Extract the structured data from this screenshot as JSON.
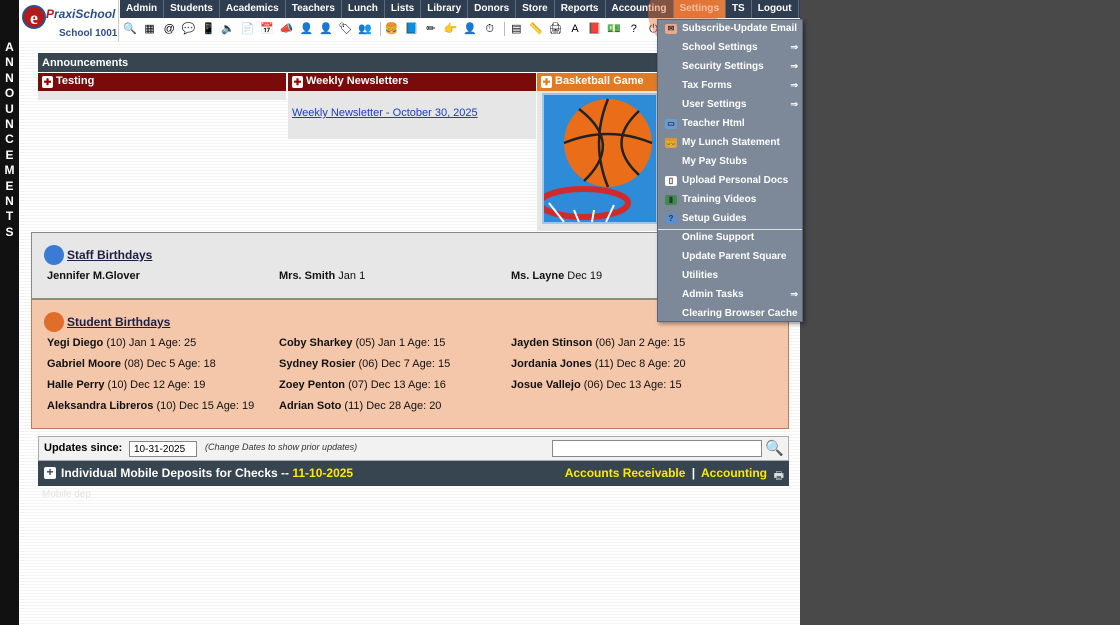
{
  "school": {
    "brand_prefix": "P",
    "brand_rest": "raxiSchool",
    "name": "School 1001",
    "logo_letter": "e"
  },
  "side_label": [
    "A",
    "N",
    "N",
    "O",
    "U",
    "N",
    "C",
    "E",
    "M",
    "E",
    "N",
    "T",
    "S"
  ],
  "nav": [
    "Admin",
    "Students",
    "Academics",
    "Teachers",
    "Lunch",
    "Lists",
    "Library",
    "Donors",
    "Store",
    "Reports",
    "Accounting",
    "Settings",
    "TS",
    "Logout"
  ],
  "toolbar_icons": [
    "search-icon",
    "calendar-grid-icon",
    "at-icon",
    "chat-icon",
    "phone-icon",
    "speaker-icon",
    "document-icon",
    "schedule-icon",
    "megaphone-icon",
    "person-red-icon",
    "person-orange-icon",
    "tag-icon",
    "group-icon",
    "lunch-icon",
    "book-icon",
    "pencil-icon",
    "hand-icon",
    "user-icon",
    "clock-icon",
    "grid-icon",
    "ruler-icon",
    "printer-icon",
    "ap-icon",
    "pdf-icon",
    "money-icon",
    "help-icon",
    "power-icon"
  ],
  "announcements": {
    "header": "Announcements",
    "columns": [
      {
        "title": "Testing",
        "color": "#7a0b0b"
      },
      {
        "title": "Weekly Newsletters",
        "color": "#7a0b0b"
      },
      {
        "title": "Basketball Game",
        "color": "#e27a23"
      }
    ],
    "newsletter_link": "Weekly Newsletter - October 30, 2025"
  },
  "staff_birthdays": {
    "title": "Staff Birthdays",
    "entries": [
      {
        "name": "Jennifer M.Glover",
        "detail": ""
      },
      {
        "name": "Mrs. Smith",
        "detail": "Jan 1"
      },
      {
        "name": "Ms. Layne",
        "detail": "Dec 19"
      }
    ]
  },
  "student_birthdays": {
    "title": "Student Birthdays",
    "entries": [
      {
        "name": "Yegi Diego",
        "detail": "(10) Jan 1 Age: 25"
      },
      {
        "name": "Coby Sharkey",
        "detail": "(05) Jan 1 Age: 15"
      },
      {
        "name": "Jayden Stinson",
        "detail": "(06) Jan 2 Age: 15"
      },
      {
        "name": "Gabriel Moore",
        "detail": "(08) Dec 5 Age: 18"
      },
      {
        "name": "Sydney Rosier",
        "detail": "(06) Dec 7 Age: 15"
      },
      {
        "name": "Jordania Jones",
        "detail": "(11) Dec 8 Age: 20"
      },
      {
        "name": "Halle Perry",
        "detail": "(10) Dec 12 Age: 19"
      },
      {
        "name": "Zoey Penton",
        "detail": "(07) Dec 13 Age: 16"
      },
      {
        "name": "Josue Vallejo",
        "detail": "(06) Dec 13 Age: 15"
      },
      {
        "name": "Aleksandra Libreros",
        "detail": "(10) Dec 15 Age: 19"
      },
      {
        "name": "Adrian Soto",
        "detail": "(11) Dec 28 Age: 20"
      }
    ]
  },
  "updates": {
    "label": "Updates since:",
    "date": "10-31-2025",
    "hint": "(Change Dates to show prior updates)",
    "search_value": ""
  },
  "deposit": {
    "title": "Individual Mobile Deposits for Checks --",
    "date": "11-10-2025",
    "link1": "Accounts Receivable",
    "divider": "|",
    "link2": "Accounting",
    "faint": "Mobile dep"
  },
  "settings_menu": [
    {
      "label": "Subscribe-Update Email",
      "icon": "email-icon",
      "arrow": false
    },
    {
      "label": "School Settings",
      "icon": "",
      "arrow": true
    },
    {
      "label": "Security Settings",
      "icon": "",
      "arrow": true
    },
    {
      "label": "Tax Forms",
      "icon": "",
      "arrow": true
    },
    {
      "label": "User Settings",
      "icon": "",
      "arrow": true
    },
    {
      "label": "Teacher Html",
      "icon": "html-icon",
      "arrow": false
    },
    {
      "label": "My Lunch Statement",
      "icon": "lunch-icon",
      "arrow": false
    },
    {
      "label": "My Pay Stubs",
      "icon": "",
      "arrow": false
    },
    {
      "label": "Upload Personal Docs",
      "icon": "document-icon",
      "arrow": false
    },
    {
      "label": "Training Videos",
      "icon": "film-icon",
      "arrow": false
    },
    {
      "label": "Setup Guides",
      "icon": "help-icon",
      "arrow": false
    },
    {
      "label": "Online Support",
      "icon": "",
      "arrow": false
    },
    {
      "label": "Update Parent Square",
      "icon": "",
      "arrow": false
    },
    {
      "label": "Utilities",
      "icon": "",
      "arrow": false
    },
    {
      "label": "Admin Tasks",
      "icon": "",
      "arrow": true
    },
    {
      "label": "Clearing Browser Cache",
      "icon": "",
      "arrow": false
    }
  ],
  "submenu_arrow": "⇒"
}
